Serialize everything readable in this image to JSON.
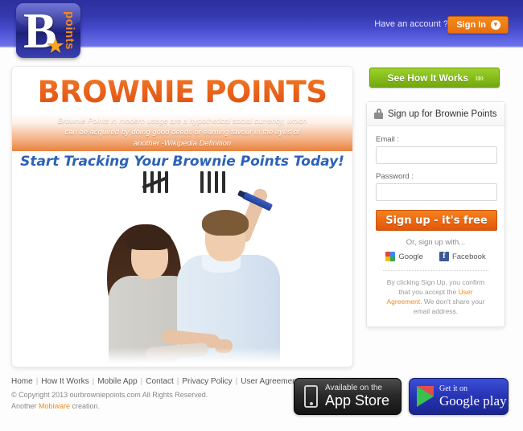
{
  "header": {
    "logo": {
      "letter": "B",
      "word": "points",
      "star_icon": "star-icon"
    },
    "account_prompt": "Have an account ?",
    "signin_label": "Sign In",
    "signin_caret": "▼"
  },
  "hero": {
    "title": "BROWNIE POINTS",
    "quote": "Brownie Points in modern usage are a hypothetical social currency, which can be acquired by doing good deeds or earning favour in the eyes of another -Wikipedia Definition",
    "subtitle": "Start Tracking Your Brownie Points Today!"
  },
  "how_it_works": {
    "label": "See How It Works",
    "chevron": "»"
  },
  "signup": {
    "heading": "Sign up for Brownie Points",
    "lock_icon": "lock-icon",
    "email_label": "Email :",
    "email_value": "",
    "email_placeholder": "",
    "password_label": "Password :",
    "password_value": "",
    "password_placeholder": "",
    "submit_label": "Sign up - it's free",
    "or_text": "Or, sign up with...",
    "google_label": "Google",
    "facebook_label": "Facebook",
    "facebook_glyph": "f",
    "disclaimer_pre": "By clicking Sign Up, you confirm that you accept the ",
    "disclaimer_link": "User Agreement",
    "disclaimer_post": ". We don't share your email address."
  },
  "footer": {
    "links": [
      "Home",
      "How It Works",
      "Mobile App",
      "Contact",
      "Privacy Policy",
      "User Agreement"
    ],
    "separator": "|",
    "copyright": "© Copyright 2013 ourbrowniepoints.com All Rights Reserved.",
    "creation_pre": "Another ",
    "creation_link": "Mobiware",
    "creation_post": " creation.",
    "appstore": {
      "line1": "Available on the",
      "line2": "App Store",
      "icon": "iphone-icon"
    },
    "googleplay": {
      "line1": "Get it on",
      "line2": "Google play",
      "icon": "play-triangle-icon"
    }
  },
  "colors": {
    "header_blue": "#2c2f9e",
    "accent_orange": "#ed6b13",
    "green": "#86bd1c",
    "link_blue": "#2b62b8"
  }
}
